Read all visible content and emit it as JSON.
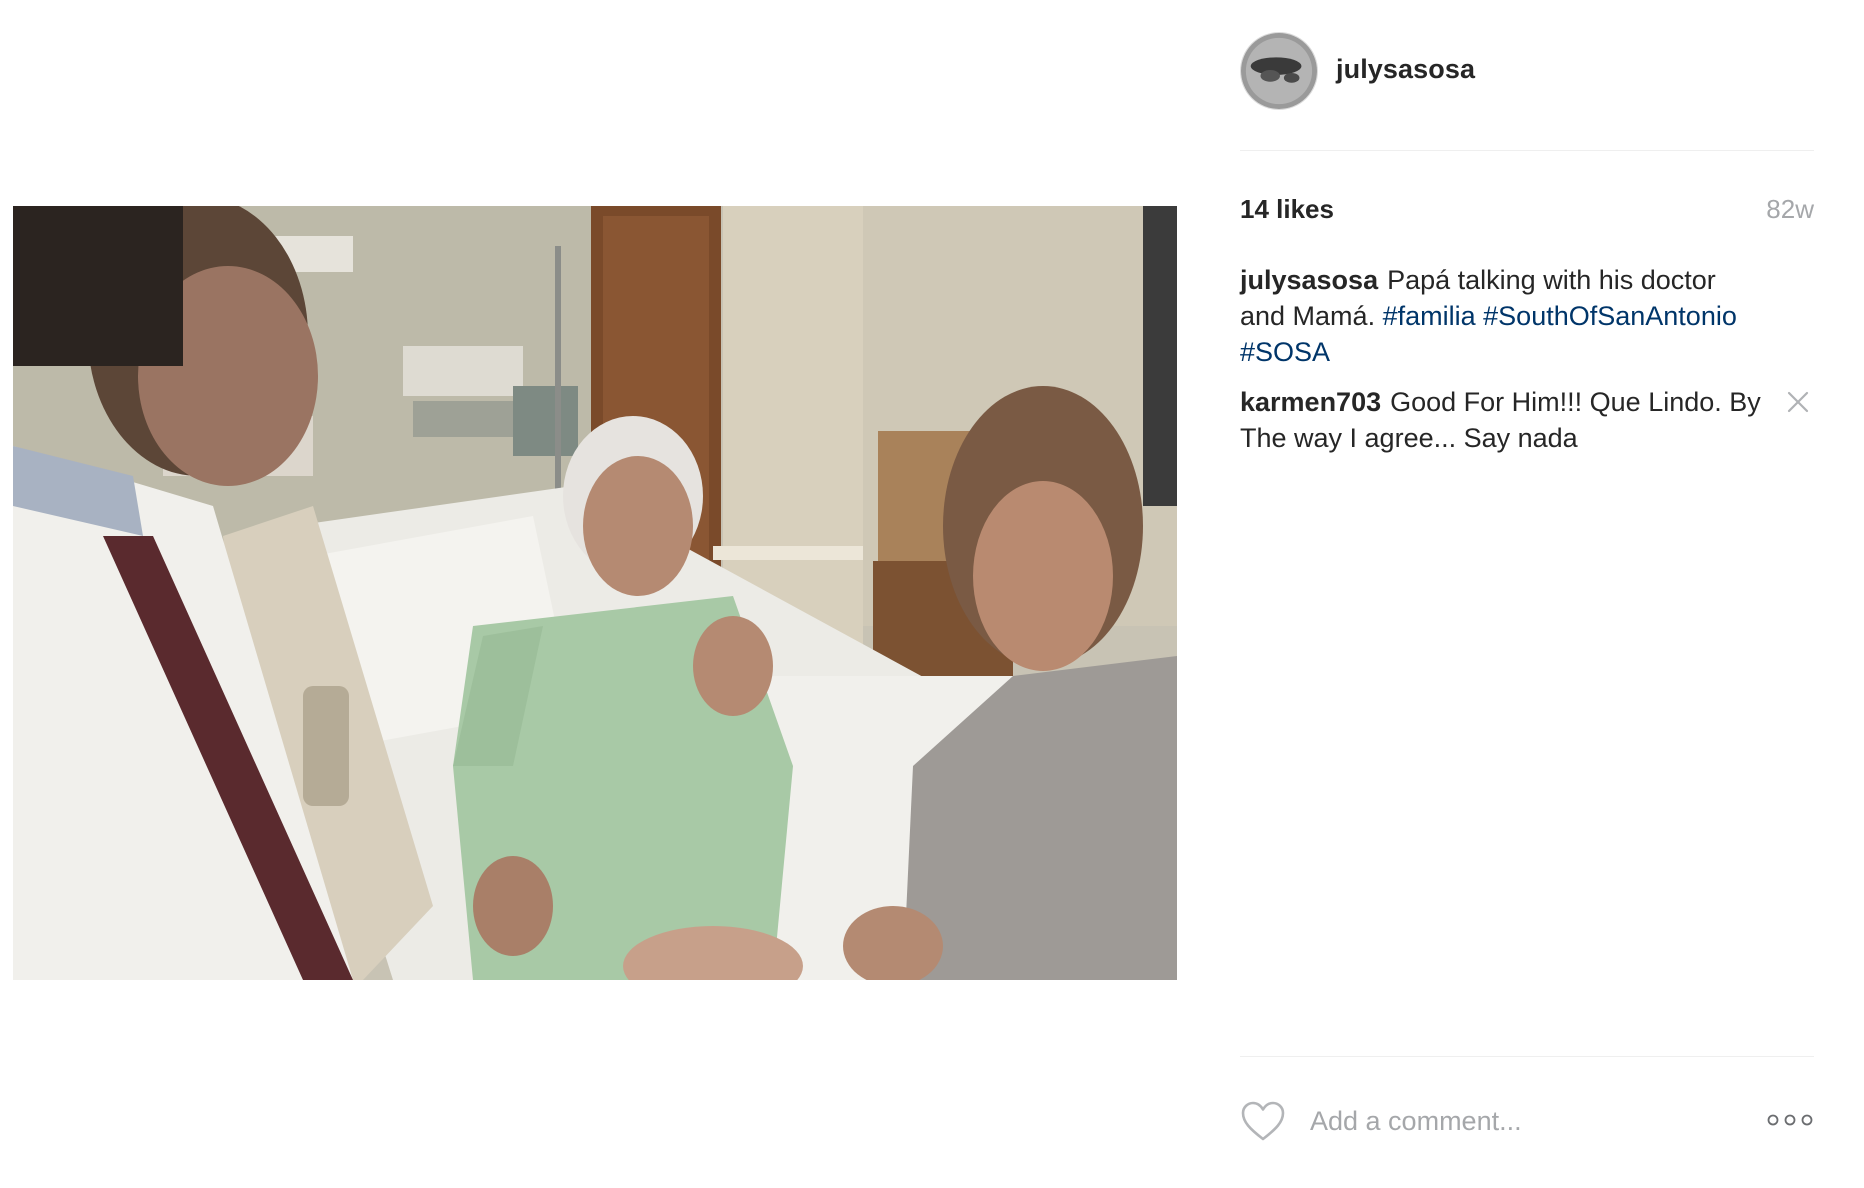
{
  "post": {
    "photo_icon": "post-photo",
    "username": "julysasosa",
    "likes": "14 likes",
    "age": "82w"
  },
  "comments": [
    {
      "author": "julysasosa",
      "text": "Papá talking with his doctor and Mamá.",
      "hashtags": [
        "#familia",
        "#SouthOfSanAntonio",
        "#SOSA"
      ],
      "deletable": false
    },
    {
      "author": "karmen703",
      "text": "Good For Him!!! Que Lindo. By The way I agree... Say nada",
      "hashtags": [],
      "deletable": true
    }
  ],
  "actions": {
    "like_icon": "heart-icon",
    "comment_placeholder": "Add a comment...",
    "more_icon": "more-options-icon"
  },
  "colors": {
    "text": "#262626",
    "muted": "#a5a7aa",
    "hashtag": "#003569",
    "divider": "#efefef"
  }
}
